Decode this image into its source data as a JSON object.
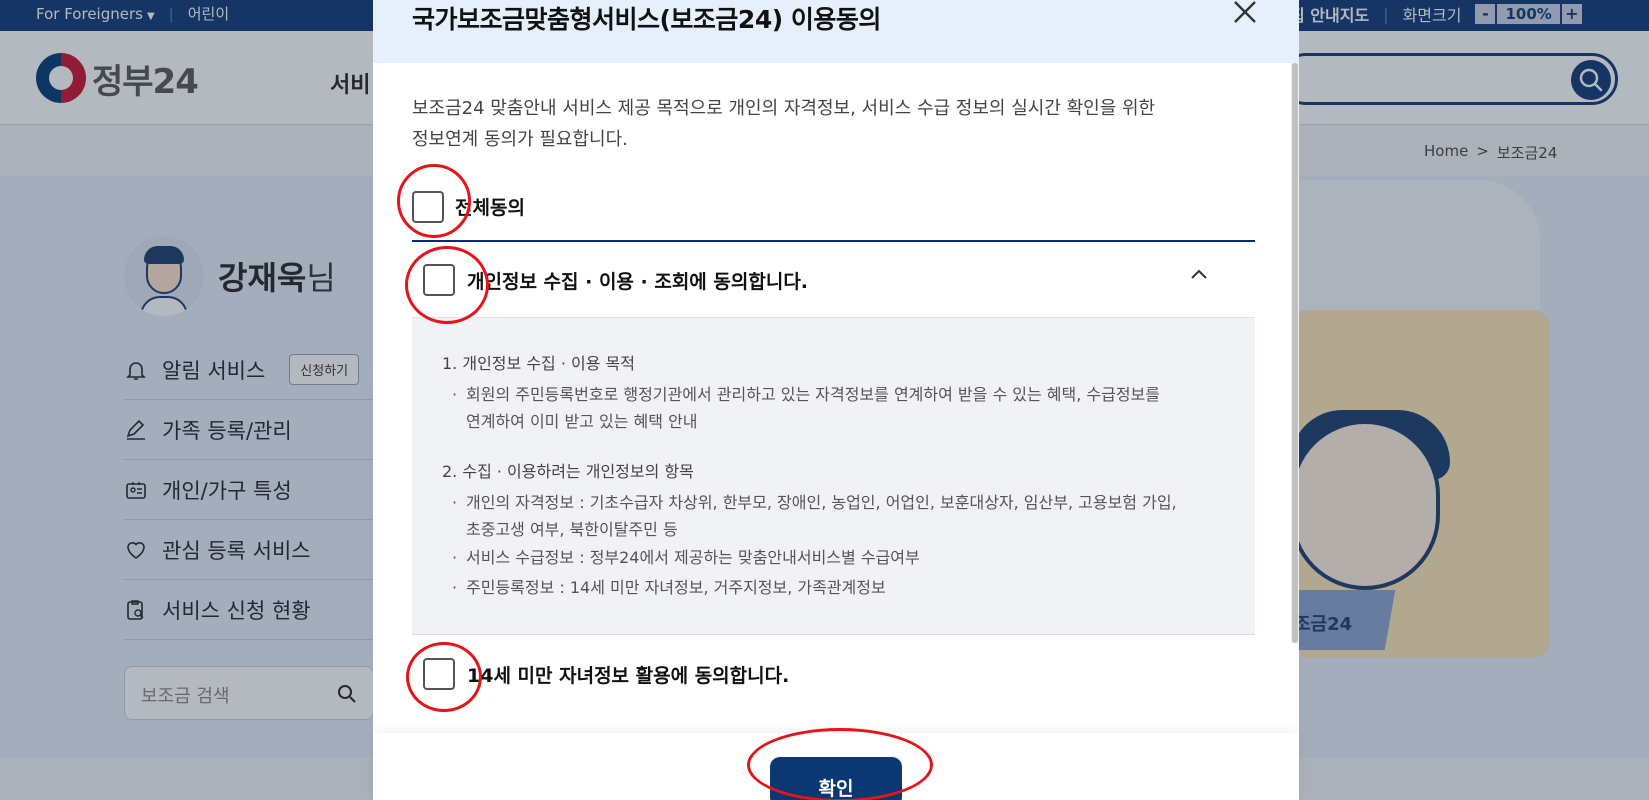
{
  "topbar": {
    "for_foreigners": "For Foreigners",
    "kids": "어린이",
    "sitemap": "집 안내지도",
    "screen_size": "화면크기",
    "zoom_minus": "-",
    "zoom_value": "100%",
    "zoom_plus": "+"
  },
  "header": {
    "logo_text": "정부24",
    "nav_partial": "서비"
  },
  "breadcrumb": {
    "home": "Home",
    "sep": ">",
    "current": "보조금24"
  },
  "profile": {
    "name": "강재욱",
    "suffix": "님"
  },
  "side_menu": [
    {
      "label": "알림 서비스",
      "icon": "bell-icon"
    },
    {
      "label": "가족 등록/관리",
      "icon": "pencil-icon"
    },
    {
      "label": "개인/가구 특성",
      "icon": "id-card-icon"
    },
    {
      "label": "관심 등록 서비스",
      "icon": "heart-icon"
    },
    {
      "label": "서비스 신청 현황",
      "icon": "clipboard-search-icon"
    }
  ],
  "apply_label": "신청하기",
  "subsidy_search_placeholder": "보조금 검색",
  "illust_label": "조금24",
  "modal": {
    "title": "국가보조금맞춤형서비스(보조금24) 이용동의",
    "intro_line1": "보조금24 맞춤안내 서비스 제공 목적으로 개인의 자격정보, 서비스 수급 정보의 실시간 확인을 위한",
    "intro_line2": "정보연계 동의가 필요합니다.",
    "agree_all": "전체동의",
    "item1_label": "개인정보 수집 · 이용 · 조회에 동의합니다.",
    "detail": {
      "h1": "1. 개인정보 수집 · 이용 목적",
      "b1_line1": "회원의 주민등록번호로 행정기관에서 관리하고 있는 자격정보를 연계하여 받을 수 있는 혜택, 수급정보를",
      "b1_line2": "연계하여 이미 받고 있는 혜택 안내",
      "h2": "2. 수집 · 이용하려는 개인정보의 항목",
      "b2_line1": "개인의 자격정보 : 기초수급자 차상위, 한부모, 장애인, 농업인, 어업인, 보훈대상자, 임산부, 고용보험 가입,",
      "b2_line2": "초중고생 여부, 북한이탈주민 등",
      "b3": "서비스 수급정보 : 정부24에서 제공하는 맞춤안내서비스별 수급여부",
      "b4": "주민등록정보 : 14세 미만 자녀정보, 거주지정보, 가족관계정보"
    },
    "item2_label": "14세 미만 자녀정보 활용에 동의합니다.",
    "confirm": "확인"
  },
  "colors": {
    "navy": "#0b3773",
    "annotation_red": "#e5141a",
    "modal_header_bg": "#e6f0fd"
  }
}
